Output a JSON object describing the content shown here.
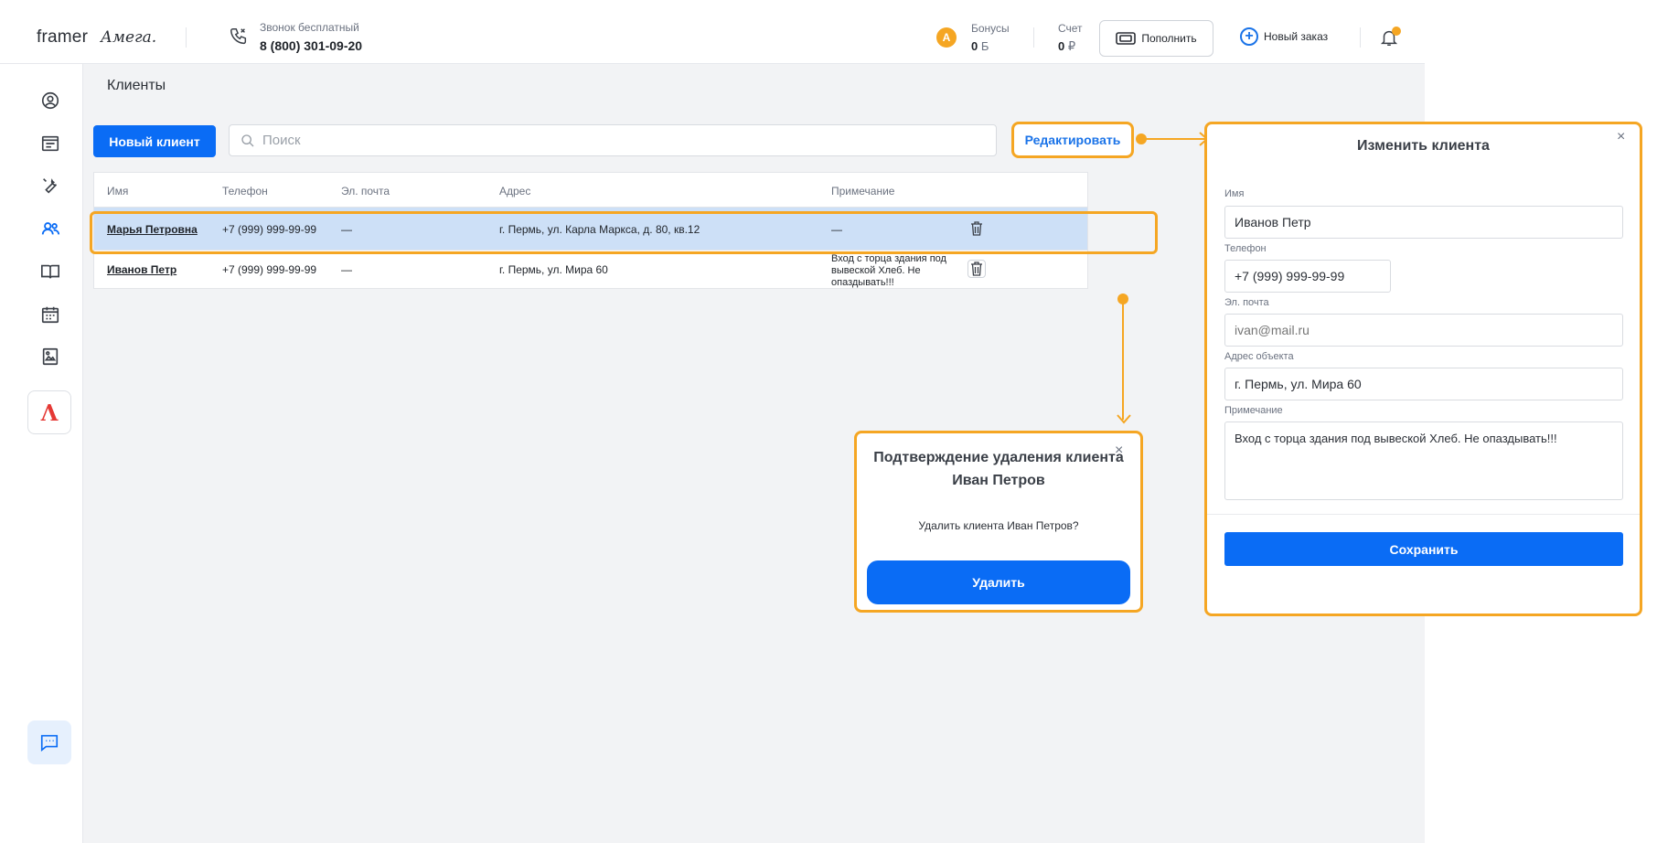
{
  "header": {
    "brand": "framer",
    "brand_mega": "Амега.",
    "phone_caption": "Звонок бесплатный",
    "phone_number": "8 (800) 301-09-20",
    "bonus_caption": "Бонусы",
    "bonus_value": "0",
    "bonus_unit": "Б",
    "account_caption": "Счет",
    "account_value": "0",
    "account_unit": "₽",
    "topup_label": "Пополнить",
    "new_order_label": "Новый заказ",
    "coin_letter": "A",
    "accent_color": "#f5a623"
  },
  "sidebar": {
    "items": [
      "profile-icon",
      "orders-icon",
      "tools-icon",
      "clients-icon",
      "catalog-icon",
      "calendar-icon",
      "gallery-icon",
      "reports-icon"
    ],
    "active": "clients-icon",
    "logo_letter": "Λ",
    "chat": "chat-icon"
  },
  "page": {
    "title": "Клиенты",
    "new_client_label": "Новый клиент",
    "search_placeholder": "Поиск",
    "edit_label": "Редактировать"
  },
  "table": {
    "columns": [
      "Имя",
      "Телефон",
      "Эл. почта",
      "Адрес",
      "Примечание"
    ],
    "rows": [
      {
        "name": "Марья Петровна",
        "phone": "+7 (999) 999-99-99",
        "email": "—",
        "address": "г. Пермь, ул. Карла Маркса, д. 80, кв.12",
        "note": "—",
        "selected": true
      },
      {
        "name": "Иванов Петр",
        "phone": "+7 (999) 999-99-99",
        "email": "—",
        "address": "г. Пермь, ул. Мира 60",
        "note": "Вход с торца здания под вывеской Хлеб. Не опаздывать!!!",
        "selected": false
      }
    ]
  },
  "delete_modal": {
    "title": "Подтверждение удаления клиента Иван Петров",
    "text": "Удалить клиента Иван Петров?",
    "button": "Удалить",
    "close": "×"
  },
  "edit_panel": {
    "title": "Изменить клиента",
    "close": "×",
    "name_label": "Имя",
    "name_value": "Иванов Петр",
    "phone_label": "Телефон",
    "phone_value": "+7 (999) 999-99-99",
    "email_label": "Эл. почта",
    "email_placeholder": "ivan@mail.ru",
    "address_label": "Адрес объекта",
    "address_value": "г. Пермь, ул. Мира 60",
    "note_label": "Примечание",
    "note_value": "Вход с торца здания под вывеской Хлеб. Не опаздывать!!!",
    "save_label": "Сохранить"
  },
  "colors": {
    "primary": "#0a6cf5",
    "highlight": "#f5a623",
    "selected_row": "#cde0f7"
  }
}
